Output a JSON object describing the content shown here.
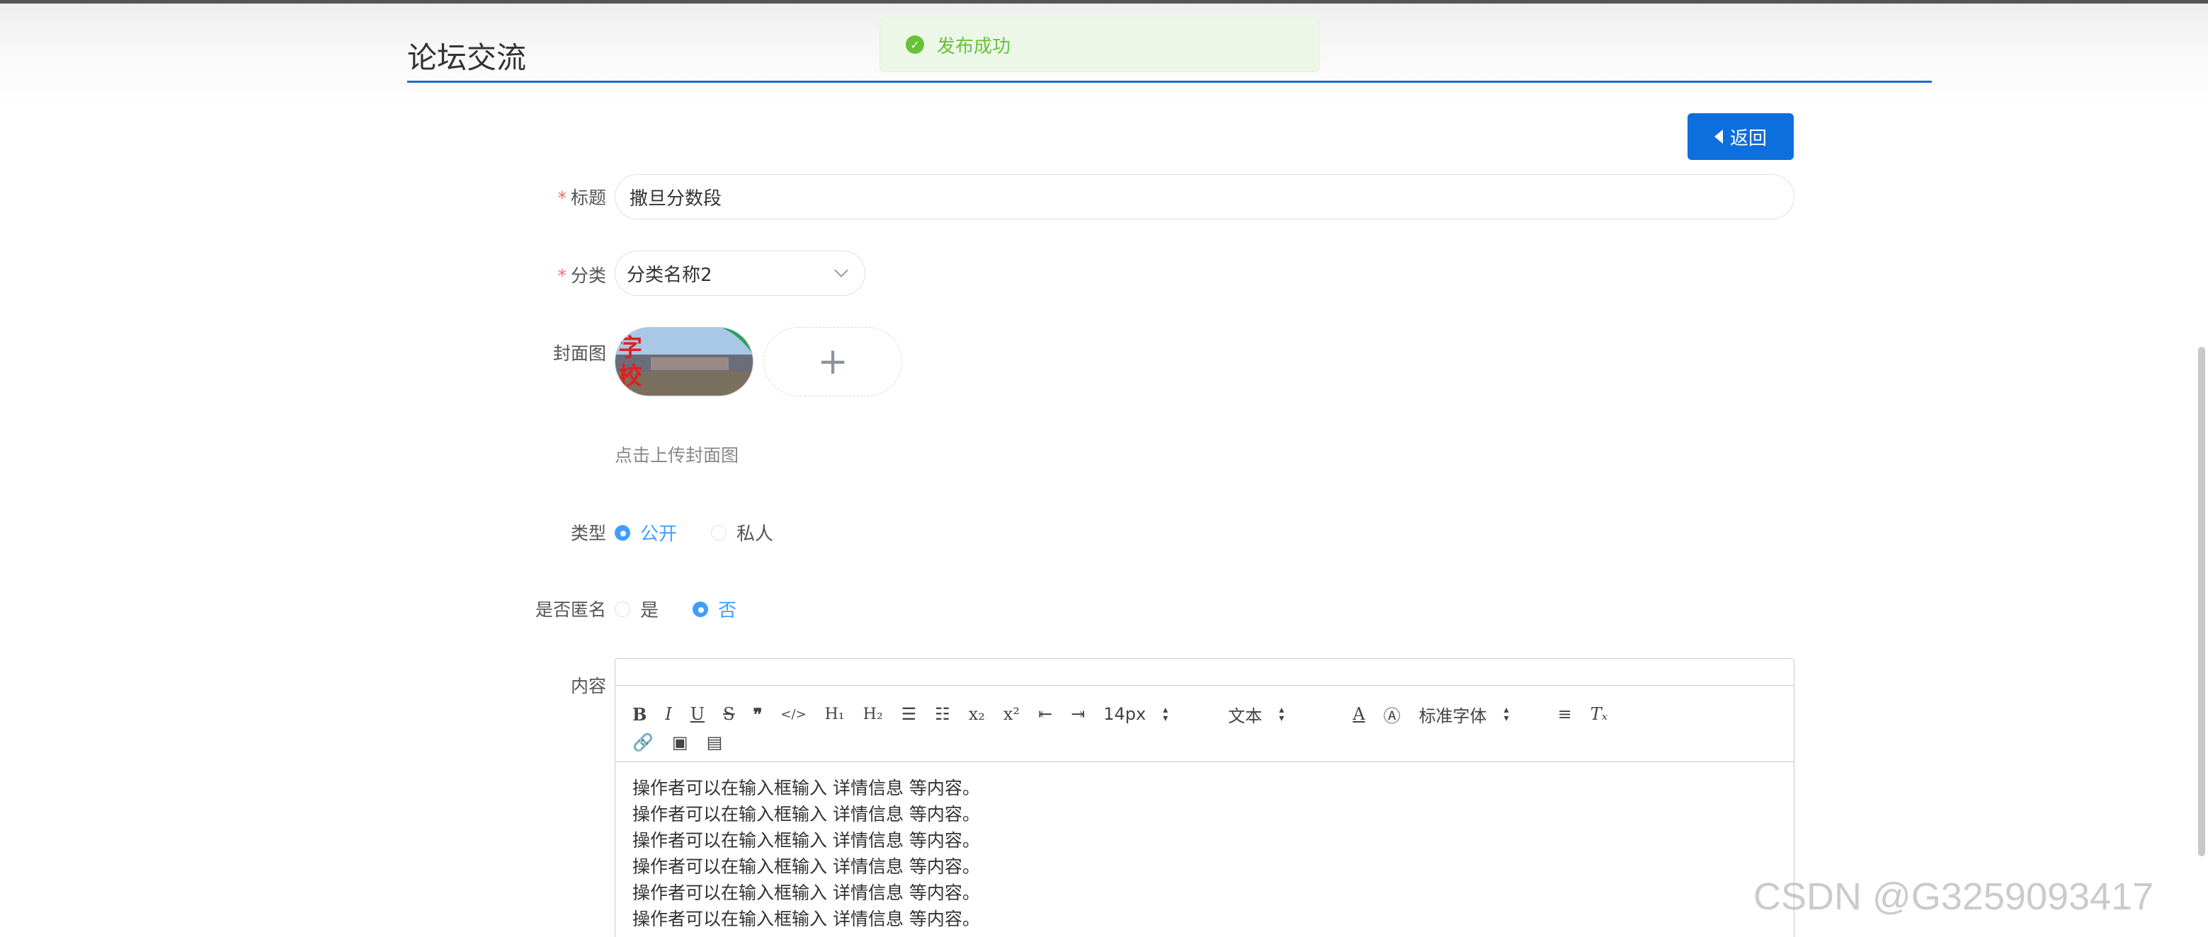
{
  "header": {
    "title": "论坛交流"
  },
  "toast": {
    "message": "发布成功",
    "icon": "check-circle-icon",
    "color": "#67c23a"
  },
  "actions": {
    "back_label": "返回"
  },
  "form": {
    "title": {
      "label": "标题",
      "value": "撒旦分数段"
    },
    "category": {
      "label": "分类",
      "value": "分类名称2"
    },
    "cover": {
      "label": "封面图",
      "hint": "点击上传封面图"
    },
    "type": {
      "label": "类型",
      "options": [
        "公开",
        "私人"
      ],
      "selected": "公开"
    },
    "anonymous": {
      "label": "是否匿名",
      "options": [
        "是",
        "否"
      ],
      "selected": "否"
    },
    "content": {
      "label": "内容",
      "toolbar": {
        "font_size": "14px",
        "header_select": "文本",
        "font_family": "标准字体"
      },
      "lines": [
        "操作者可以在输入框输入  详情信息  等内容。",
        "操作者可以在输入框输入  详情信息  等内容。",
        "操作者可以在输入框输入  详情信息  等内容。",
        "操作者可以在输入框输入  详情信息  等内容。",
        "操作者可以在输入框输入  详情信息  等内容。",
        "操作者可以在输入框输入  详情信息  等内容。"
      ]
    }
  },
  "watermark": "CSDN @G3259093417",
  "colors": {
    "primary": "#0d6ede",
    "accent": "#409eff",
    "required": "#f56c6c"
  }
}
